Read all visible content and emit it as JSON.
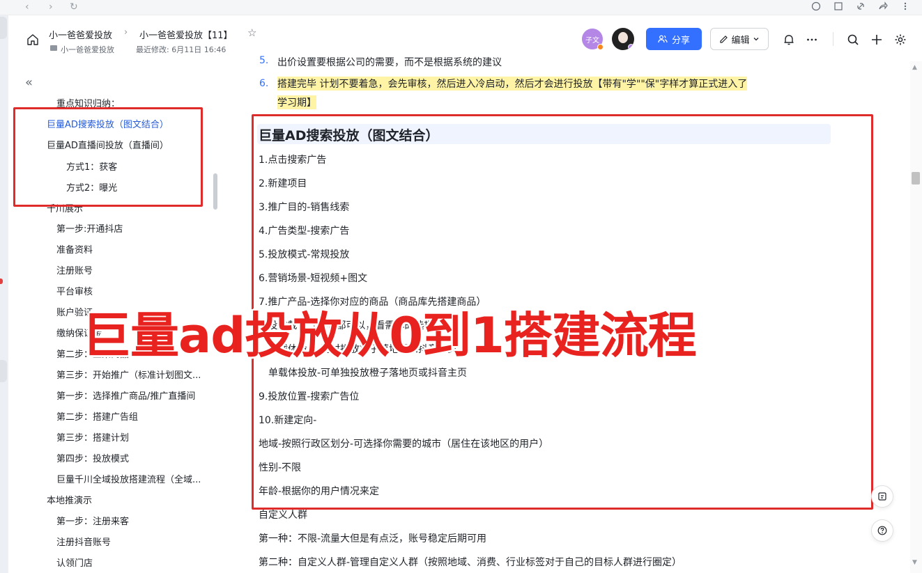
{
  "header": {
    "breadcrumb_parent": "小一爸爸爱投放",
    "breadcrumb_current": "小一爸爸爱投放【11】",
    "folder_label": "小一爸爸爱投放",
    "last_modified": "最近修改: 6月11日 16:46",
    "avatar_initials": "子文",
    "share_label": "分享",
    "edit_label": "编辑"
  },
  "toc": {
    "items": [
      {
        "label": "重点知识归纳："
      },
      {
        "label": "巨量AD搜索投放（图文结合）"
      },
      {
        "label": "巨量AD直播间投放（直播间）"
      },
      {
        "label": "方式1：获客"
      },
      {
        "label": "方式2：曝光"
      },
      {
        "label": "千川展示"
      },
      {
        "label": "第一步:开通抖店"
      },
      {
        "label": "准备资料"
      },
      {
        "label": "注册账号"
      },
      {
        "label": "平台审核"
      },
      {
        "label": "账户验证"
      },
      {
        "label": "缴纳保证金"
      },
      {
        "label": "第二步：上架商品"
      },
      {
        "label": "第三步：开始推广（标准计划图文..."
      },
      {
        "label": "第一步：选择推广商品/推广直播间"
      },
      {
        "label": "第二步：搭建广告组"
      },
      {
        "label": "第三步：搭建计划"
      },
      {
        "label": "第四步：投放模式"
      },
      {
        "label": "巨量千川全域投放搭建流程（全域..."
      },
      {
        "label": "本地推演示"
      },
      {
        "label": "第一步：注册来客"
      },
      {
        "label": "注册抖音账号"
      },
      {
        "label": "认领门店"
      }
    ]
  },
  "content": {
    "item5_num": "5.",
    "item5_text": "出价设置要根据公司的需要，而不是根据系统的建议",
    "item6_num": "6.",
    "item6_line1": "搭建完毕 计划不要着急，会先审核，然后进入冷启动，然后才会进行投放【带有\"学\"\"保\"字样才算正式进入了",
    "item6_line2": "学习期】",
    "heading": "巨量AD搜索投放（图文结合）",
    "lines": [
      "1.点击搜索广告",
      "2.新建项目",
      "3.推广目的-销售线索",
      "4.广告类型-搜索广告",
      "5.投放模式-常规投放",
      "6.营销场景-短视频+图文",
      "7.推广产品-选择你对应的商品（商品库先搭建商品）",
      "8.投放载体（二者都可以，看需你的选择）",
      "   多载体投放-同时投放橙子落地页和抖音主页",
      "   单载体投放-可单独投放橙子落地页或抖音主页",
      "9.投放位置-搜索广告位",
      "10.新建定向-",
      "地域-按照行政区划分-可选择你需要的城市（居住在该地区的用户）",
      "性别-不限",
      "年龄-根据你的用户情况来定",
      "自定义人群",
      "第一种：不限-流量大但是有点泛，账号稳定后期可用",
      "第二种：自定义人群-管理自定义人群（按照地域、消费、行业标签对于自己的目标人群进行圈定）"
    ]
  },
  "overlay": {
    "title": "巨量ad投放从0到1搭建流程"
  },
  "colors": {
    "accent": "#3370ff",
    "highlight_red": "#e02b2b",
    "text_highlight": "#fff3a6"
  }
}
